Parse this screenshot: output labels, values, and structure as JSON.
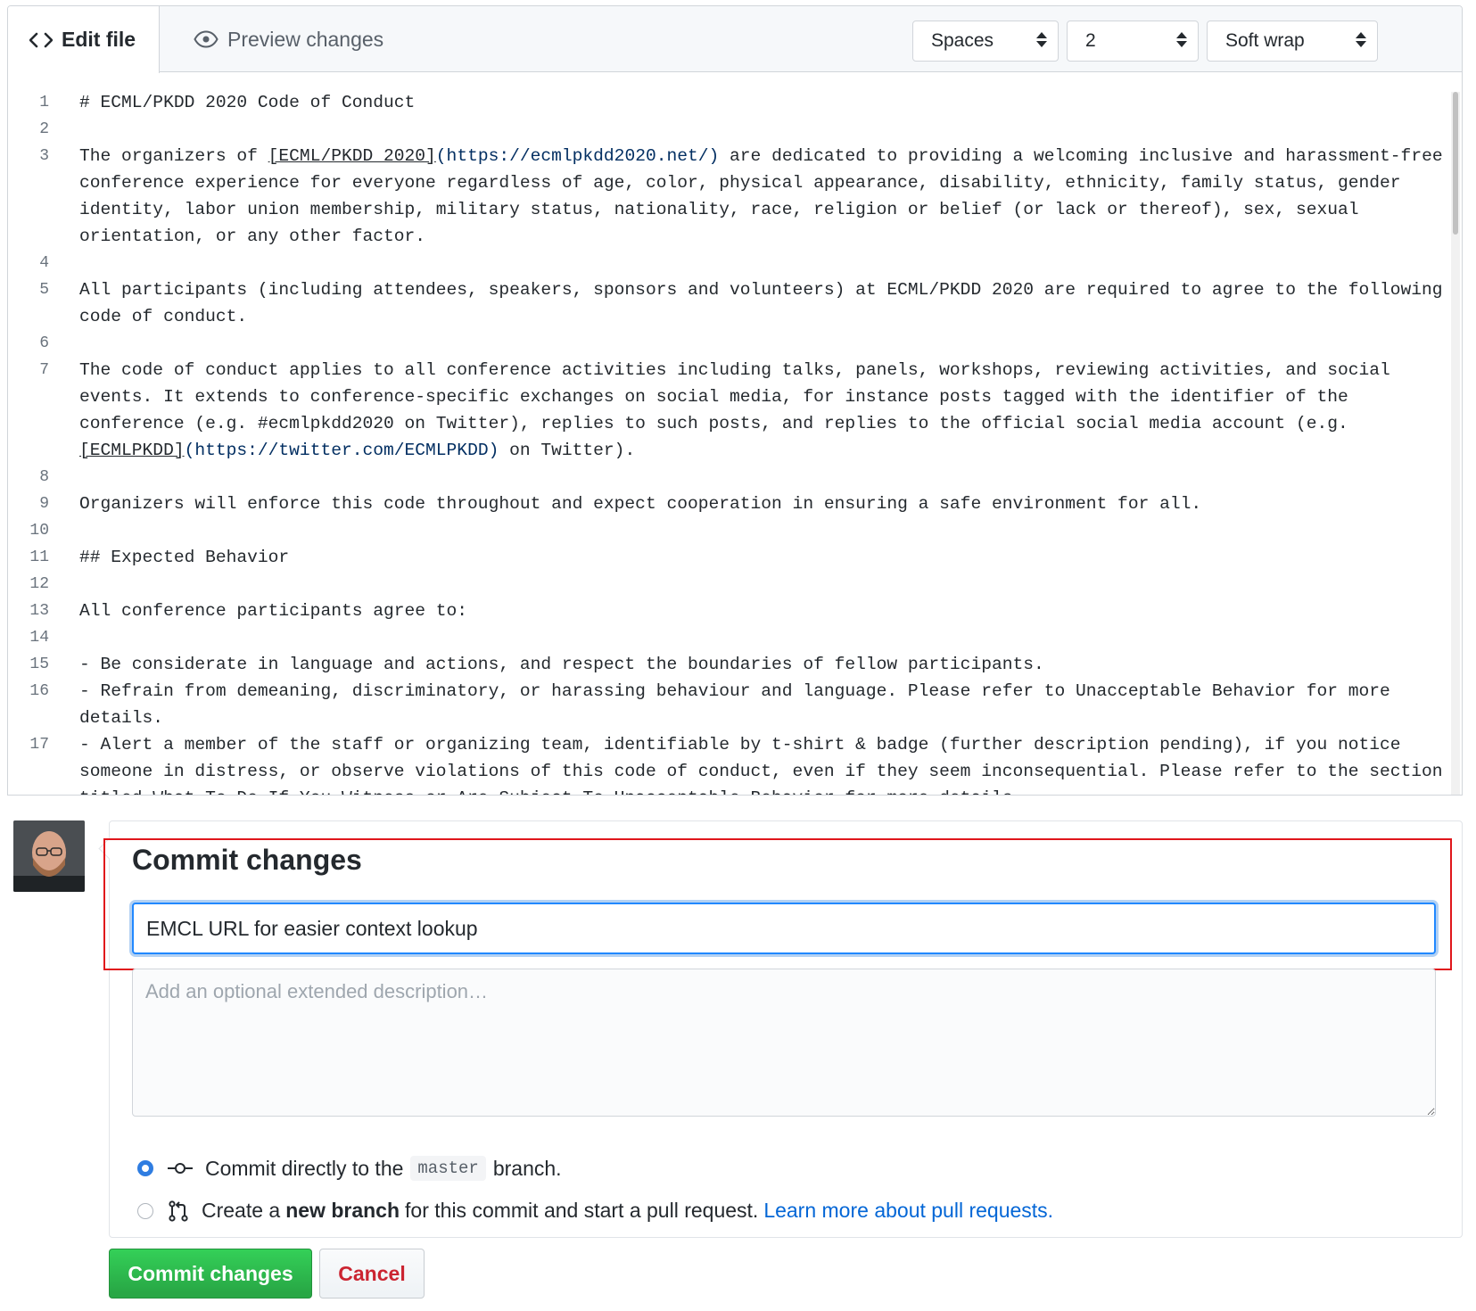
{
  "editor": {
    "tabs": {
      "edit_label": "Edit file",
      "preview_label": "Preview changes"
    },
    "indent_mode": "Spaces",
    "indent_size": "2",
    "wrap_mode": "Soft wrap"
  },
  "code_lines": [
    {
      "n": "1",
      "html_key": "l1"
    },
    {
      "n": "2"
    },
    {
      "n": "3"
    },
    {
      "n": "4"
    },
    {
      "n": "5"
    },
    {
      "n": "6"
    },
    {
      "n": "7"
    },
    {
      "n": "8"
    },
    {
      "n": "9"
    },
    {
      "n": "10"
    },
    {
      "n": "11"
    },
    {
      "n": "12"
    },
    {
      "n": "13"
    },
    {
      "n": "14"
    },
    {
      "n": "15"
    },
    {
      "n": "16"
    },
    {
      "n": "17"
    }
  ],
  "code": {
    "l1": "# ECML/PKDD 2020 Code of Conduct",
    "l3_pre": "The organizers of ",
    "l3_link": "[ECML/PKDD 2020]",
    "l3_url": "(https://ecmlpkdd2020.net/)",
    "l3_post": " are dedicated to providing a welcoming inclusive and harassment-free conference experience for everyone regardless of age, color, physical appearance, disability, ethnicity, family status, gender identity, labor union membership, military status, nationality, race, religion or belief (or lack or thereof), sex, sexual orientation, or any other factor.",
    "l5": "All participants (including attendees, speakers, sponsors and volunteers) at ECML/PKDD 2020 are required to agree to the following code of conduct.",
    "l7_pre": "The code of conduct applies to all conference activities including talks, panels, workshops, reviewing activities, and social events. It extends to conference-specific exchanges on social media, for instance posts tagged with the identifier of the conference (e.g. #ecmlpkdd2020 on Twitter), replies to such posts, and replies to the official social media account (e.g. ",
    "l7_link": "[ECMLPKDD]",
    "l7_url": "(https://twitter.com/ECMLPKDD)",
    "l7_post": " on Twitter).",
    "l9": "Organizers will enforce this code throughout and expect cooperation in ensuring a safe environment for all.",
    "l11_hash": "## ",
    "l11_title": "Expected Behavior",
    "l13": "All conference participants agree to:",
    "l15": "- Be considerate in language and actions, and respect the boundaries of fellow participants.",
    "l16": "- Refrain from demeaning, discriminatory, or harassing behaviour and language. Please refer to Unacceptable Behavior for more details.",
    "l17": "- Alert a member of the staff or organizing team, identifiable by t-shirt & badge (further description pending), if you notice someone in distress, or observe violations of this code of conduct, even if they seem inconsequential. Please refer to the section titled What To Do If You Witness or Are Subject To Unacceptable Behavior for more details."
  },
  "commit": {
    "title": "Commit changes",
    "summary_value": "EMCL URL for easier context lookup",
    "description_placeholder": "Add an optional extended description…",
    "option_direct": {
      "pre": "Commit directly to the",
      "branch": "master",
      "post": "branch."
    },
    "option_new": {
      "pre": "Create a",
      "strong": "new branch",
      "post": "for this commit and start a pull request.",
      "link": "Learn more about pull requests."
    },
    "submit_label": "Commit changes",
    "cancel_label": "Cancel"
  },
  "colors": {
    "accent_blue": "#2188ff",
    "primary_green": "#28a745",
    "cancel_red": "#cb2431",
    "highlight_red": "#e0161b"
  }
}
